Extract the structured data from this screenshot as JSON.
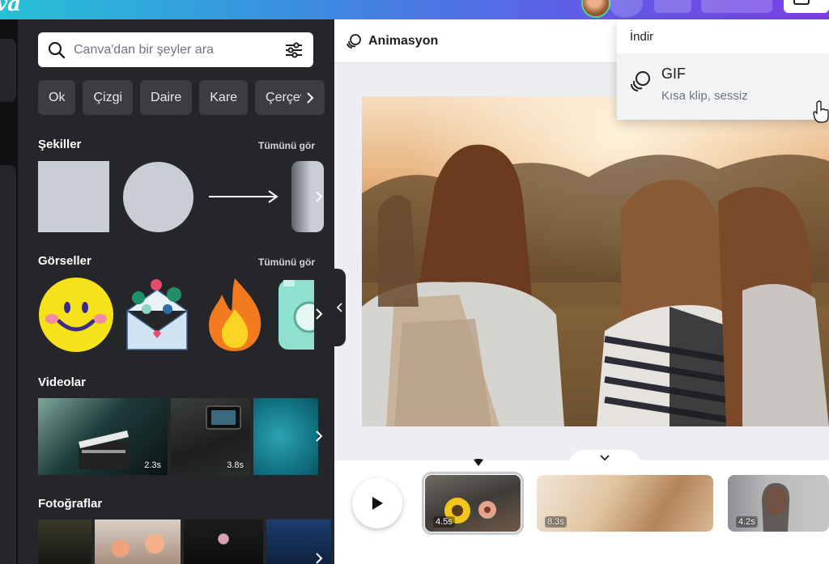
{
  "search": {
    "placeholder": "Canva'dan bir şeyler ara"
  },
  "chips": [
    "Ok",
    "Çizgi",
    "Daire",
    "Kare",
    "Çerçeve"
  ],
  "sections": {
    "shapes": {
      "title": "Şekiller",
      "see_all": "Tümünü gör"
    },
    "graphics": {
      "title": "Görseller",
      "see_all": "Tümünü gör"
    },
    "videos": {
      "title": "Videolar",
      "durations": [
        "2.3s",
        "3.8s"
      ]
    },
    "photos": {
      "title": "Fotoğraflar"
    }
  },
  "main": {
    "toolbar_label": "Animasyon"
  },
  "timeline": {
    "clips": [
      "4.5s",
      "8.3s",
      "4.2s"
    ]
  },
  "dropdown": {
    "header": "İndir",
    "item": {
      "title": "GIF",
      "subtitle": "Kısa klip, sessiz"
    }
  },
  "colors": {
    "panel": "#252629",
    "accent_gradient_start": "#27c0d6",
    "accent_gradient_end": "#7b3fe4"
  }
}
